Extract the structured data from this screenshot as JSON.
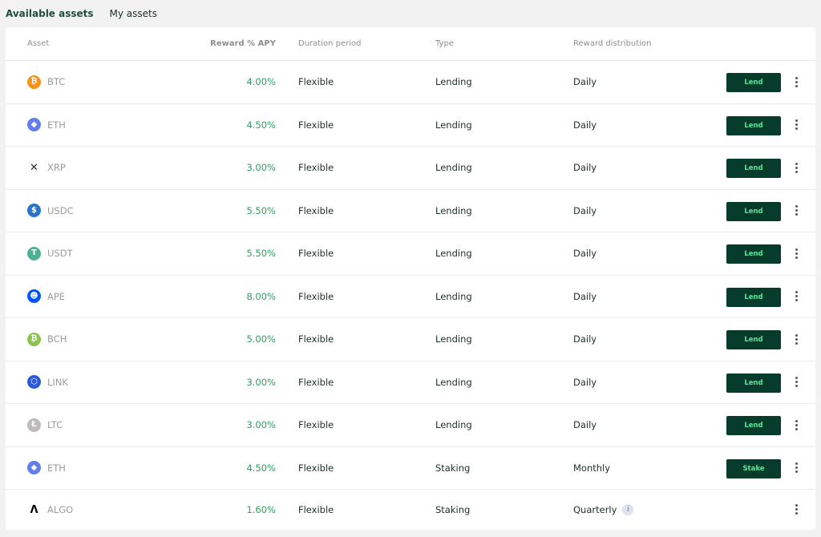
{
  "tabs": [
    {
      "label": "Available assets",
      "active": true
    },
    {
      "label": "My assets",
      "active": false
    }
  ],
  "table": {
    "headers": {
      "asset": "Asset",
      "apy": "Reward % APY",
      "duration": "Duration period",
      "type": "Type",
      "distribution": "Reward distribution"
    },
    "rows": [
      {
        "asset": "BTC",
        "icon": "bitcoin-icon",
        "color": "#f7931a",
        "glyph": "₿",
        "apy": "4.00%",
        "duration": "Flexible",
        "type": "Lending",
        "distribution": "Daily",
        "action": "Lend",
        "info": false
      },
      {
        "asset": "ETH",
        "icon": "ethereum-icon",
        "color": "#627eea",
        "glyph": "◆",
        "apy": "4.50%",
        "duration": "Flexible",
        "type": "Lending",
        "distribution": "Daily",
        "action": "Lend",
        "info": false
      },
      {
        "asset": "XRP",
        "icon": "xrp-icon",
        "color": "#23292f",
        "glyph": "✕",
        "apy": "3.00%",
        "duration": "Flexible",
        "type": "Lending",
        "distribution": "Daily",
        "action": "Lend",
        "info": false
      },
      {
        "asset": "USDC",
        "icon": "usdc-icon",
        "color": "#2775ca",
        "glyph": "$",
        "apy": "5.50%",
        "duration": "Flexible",
        "type": "Lending",
        "distribution": "Daily",
        "action": "Lend",
        "info": false
      },
      {
        "asset": "USDT",
        "icon": "tether-icon",
        "color": "#50af95",
        "glyph": "T",
        "apy": "5.50%",
        "duration": "Flexible",
        "type": "Lending",
        "distribution": "Daily",
        "action": "Lend",
        "info": false
      },
      {
        "asset": "APE",
        "icon": "apecoin-icon",
        "color": "#0054f9",
        "glyph": "☻",
        "apy": "8.00%",
        "duration": "Flexible",
        "type": "Lending",
        "distribution": "Daily",
        "action": "Lend",
        "info": false
      },
      {
        "asset": "BCH",
        "icon": "bitcoin-cash-icon",
        "color": "#8dc351",
        "glyph": "₿",
        "apy": "5.00%",
        "duration": "Flexible",
        "type": "Lending",
        "distribution": "Daily",
        "action": "Lend",
        "info": false
      },
      {
        "asset": "LINK",
        "icon": "chainlink-icon",
        "color": "#2a5ada",
        "glyph": "⬡",
        "apy": "3.00%",
        "duration": "Flexible",
        "type": "Lending",
        "distribution": "Daily",
        "action": "Lend",
        "info": false
      },
      {
        "asset": "LTC",
        "icon": "litecoin-icon",
        "color": "#bfbbbb",
        "glyph": "Ł",
        "apy": "3.00%",
        "duration": "Flexible",
        "type": "Lending",
        "distribution": "Daily",
        "action": "Lend",
        "info": false
      },
      {
        "asset": "ETH",
        "icon": "ethereum-icon",
        "color": "#627eea",
        "glyph": "◆",
        "apy": "4.50%",
        "duration": "Flexible",
        "type": "Staking",
        "distribution": "Monthly",
        "action": "Stake",
        "info": false
      },
      {
        "asset": "ALGO",
        "icon": "algorand-icon",
        "color": "#000000",
        "glyph": "Λ",
        "apy": "1.60%",
        "duration": "Flexible",
        "type": "Staking",
        "distribution": "Quarterly",
        "action": "",
        "info": true
      }
    ]
  },
  "colors": {
    "button_bg": "#073b2b",
    "button_text": "#5fe39b",
    "apy_text": "#2f9e5e",
    "active_tab": "#1f4d3f"
  },
  "info_icon_glyph": "i"
}
